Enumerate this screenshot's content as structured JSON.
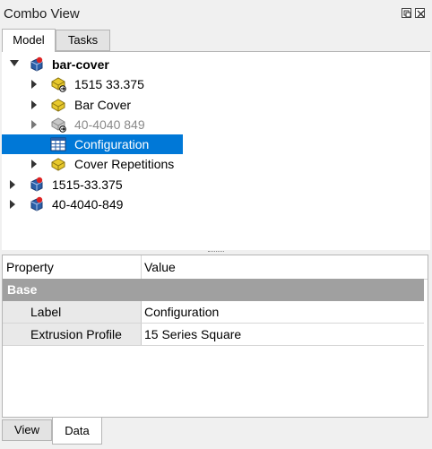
{
  "window": {
    "title": "Combo View"
  },
  "top_tabs": {
    "model": "Model",
    "tasks": "Tasks"
  },
  "tree": {
    "root_label": "bar-cover",
    "child1": "1515 33.375",
    "child2": "Bar Cover",
    "child3": "40-4040 849",
    "child4": "Configuration",
    "child5": "Cover Repetitions",
    "top2": "1515-33.375",
    "top3": "40-4040-849"
  },
  "property_grid": {
    "col_property": "Property",
    "col_value": "Value",
    "group": "Base",
    "rows": [
      {
        "key": "Label",
        "value": "Configuration"
      },
      {
        "key": "Extrusion Profile",
        "value": "15 Series Square"
      }
    ]
  },
  "bottom_tabs": {
    "view": "View",
    "data": "Data"
  },
  "colors": {
    "selection": "#0078d7",
    "group_header": "#a0a0a0",
    "part_blue": "#2a5fa8",
    "part_red": "#d22",
    "folder_yellow": "#e8c92c"
  }
}
